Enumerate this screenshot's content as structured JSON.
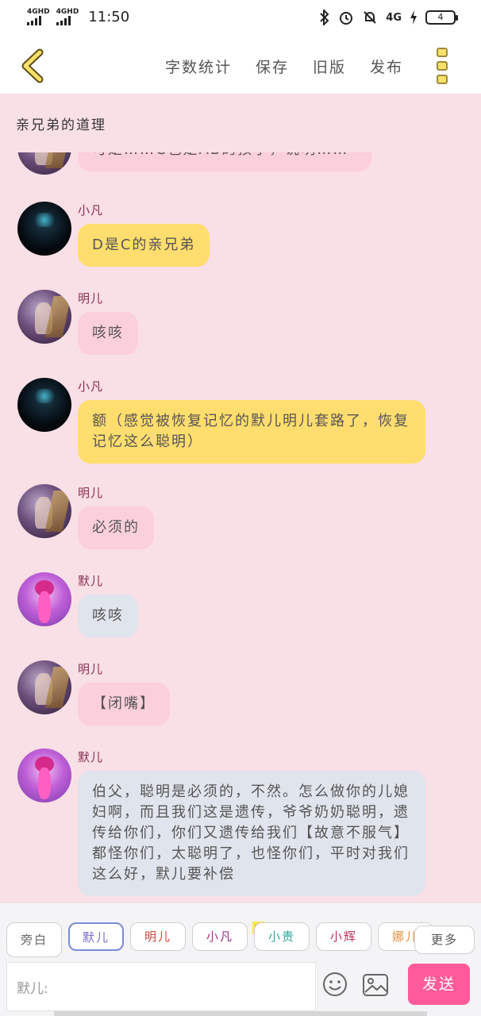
{
  "status": {
    "sim1": "4GHD",
    "sim2": "4GHD",
    "time": "11:50",
    "net": "4G",
    "battery": "4"
  },
  "toolbar": {
    "word_count": "字数统计",
    "save": "保存",
    "old_version": "旧版",
    "publish": "发布"
  },
  "story_title": "亲兄弟的道理",
  "messages": [
    {
      "text": "可是……C也是AB的孩子，说明……"
    },
    {
      "name": "小凡",
      "text": "D是C的亲兄弟"
    },
    {
      "name": "明儿",
      "text": "咳咳"
    },
    {
      "name": "小凡",
      "text": "额（感觉被恢复记忆的默儿明儿套路了，恢复记忆这么聪明）"
    },
    {
      "name": "明儿",
      "text": "必须的"
    },
    {
      "name": "默儿",
      "text": "咳咳"
    },
    {
      "name": "明儿",
      "text": "【闭嘴】"
    },
    {
      "name": "默儿",
      "text": "伯父，聪明是必须的，不然。怎么做你的儿媳妇啊，而且我们这是遗传，爷爷奶奶聪明，遗传给你们，你们又遗传给我们【故意不服气】都怪你们，太聪明了，也怪你们，平时对我们这么好，默儿要补偿"
    }
  ],
  "characters": {
    "narration": "旁白",
    "c1": "默儿",
    "c2": "明儿",
    "c3": "小凡",
    "c4": "小贵",
    "c5": "小辉",
    "c6": "娜儿",
    "crown": "主",
    "more": "更多"
  },
  "input": {
    "prefix": "默儿:"
  },
  "send_label": "发送"
}
